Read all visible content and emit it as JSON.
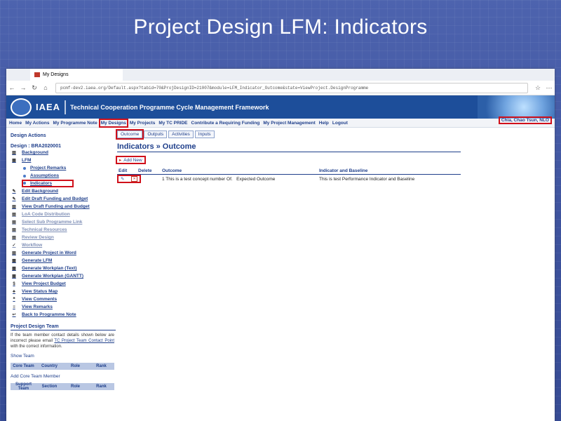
{
  "slide_title": "Project Design LFM: Indicators",
  "browser": {
    "tab_title": "My Designs",
    "url": "pcmf-dev2.iaea.org/Default.aspx?tabid=70&ProjDesignID=21007&module=LFM_Indicator_Outcome&state=ViewProject.DesignProgramme"
  },
  "banner": {
    "org": "IAEA",
    "framework": "Technical Cooperation Programme Cycle Management Framework"
  },
  "menu": {
    "items": [
      "Home",
      "My Actions",
      "My Programme Note",
      "My Designs",
      "My Projects",
      "My TC PRIDE",
      "Contribute a Requiring Funding",
      "My Project Management",
      "Help",
      "Logout"
    ],
    "user": "Chia, Chao Tsun, NLO"
  },
  "left": {
    "title": "Design Actions",
    "design_code": "Design : BRA2020001",
    "actions": [
      {
        "label": "Background",
        "icon": "doc-icon"
      },
      {
        "label": "LFM",
        "icon": "lfm-icon"
      }
    ],
    "lfm_sub": [
      "Project Remarks",
      "Assumptions",
      "Indicators"
    ],
    "more_actions": [
      {
        "label": "Edit Background",
        "dim": false
      },
      {
        "label": "Edit Draft Funding and Budget",
        "dim": false
      },
      {
        "label": "View Draft Funding and Budget",
        "dim": false
      },
      {
        "label": "LoA Code Distribution",
        "dim": true
      },
      {
        "label": "Select Sub Programme Link",
        "dim": true
      },
      {
        "label": "Technical Resources",
        "dim": true
      },
      {
        "label": "Review Design",
        "dim": true
      },
      {
        "label": "Workflow",
        "dim": true
      },
      {
        "label": "Generate Project in Word",
        "dim": false
      },
      {
        "label": "Generate LFM",
        "dim": false
      },
      {
        "label": "Generate Workplan (Text)",
        "dim": false
      },
      {
        "label": "Generate Workplan (GANTT)",
        "dim": false
      },
      {
        "label": "View Project Budget",
        "dim": false
      },
      {
        "label": "View Status Map",
        "dim": false
      },
      {
        "label": "View Comments",
        "dim": false
      },
      {
        "label": "View Remarks",
        "dim": false
      },
      {
        "label": "Back to Programme Note",
        "dim": false
      }
    ],
    "team_title": "Project Design Team",
    "team_text_1": "If the team member contact details shown below are incorrect please email ",
    "team_link": "TC Project Team Contact Point",
    "team_text_2": " with the correct information.",
    "show_team": "Show Team",
    "core_headers": [
      "Core Team",
      "Country",
      "Role",
      "Rank"
    ],
    "add_core": "Add Core Team Member",
    "support_headers": [
      "Support Team",
      "Section",
      "Role",
      "Rank"
    ]
  },
  "main": {
    "tabs": [
      "Outcome",
      "Outputs",
      "Activities",
      "Inputs"
    ],
    "heading": "Indicators » Outcome",
    "add_new": "Add New",
    "table_headers": [
      "Edit",
      "Delete",
      "Outcome",
      "Indicator and Baseline"
    ],
    "rows": [
      {
        "outcome": "1 This is a test concept number Of.",
        "expected": "Expected Outcome",
        "indicator": "This is test Performance Indicator and Baseline"
      }
    ]
  }
}
